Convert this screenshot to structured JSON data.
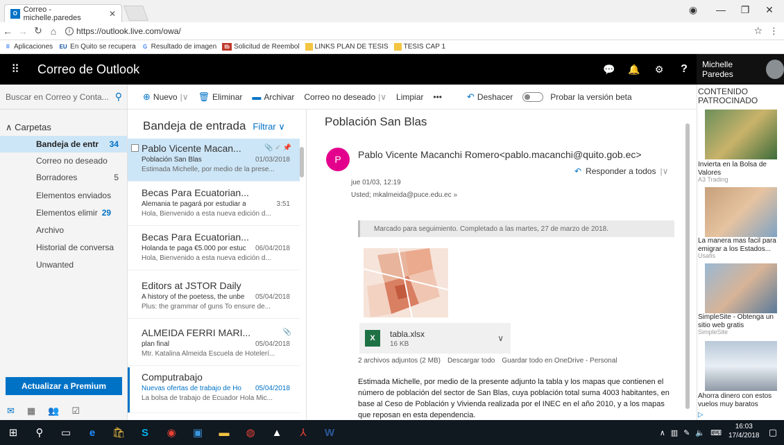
{
  "browser": {
    "tab_title": "Correo - michelle.paredes",
    "tab_icon": "O",
    "url": "https://outlook.live.com/owa/",
    "bookmarks": [
      {
        "label": "Aplicaciones"
      },
      {
        "label": "En Quito se recupera",
        "badge": "EU"
      },
      {
        "label": "Resultado de imagen",
        "badge": "G"
      },
      {
        "label": "Solicitud de Reembol",
        "badge": "tb"
      },
      {
        "label": "LINKS PLAN DE TESIS"
      },
      {
        "label": "TESIS CAP 1"
      }
    ]
  },
  "header": {
    "app_title": "Correo de Outlook",
    "user_name": "Michelle Paredes"
  },
  "search": {
    "placeholder": "Buscar en Correo y Conta..."
  },
  "folders": {
    "heading": "Carpetas",
    "items": [
      {
        "label": "Bandeja de entr",
        "count": "34"
      },
      {
        "label": "Correo no deseado",
        "count": ""
      },
      {
        "label": "Borradores",
        "count": "5"
      },
      {
        "label": "Elementos enviados",
        "count": ""
      },
      {
        "label": "Elementos elimir",
        "count": "29"
      },
      {
        "label": "Archivo",
        "count": ""
      },
      {
        "label": "Historial de conversa",
        "count": ""
      },
      {
        "label": "Unwanted",
        "count": ""
      }
    ]
  },
  "premium_label": "Actualizar a Premium",
  "commands": {
    "new": "Nuevo",
    "delete": "Eliminar",
    "archive": "Archivar",
    "junk": "Correo no deseado",
    "sweep": "Limpiar",
    "more": "•••",
    "undo": "Deshacer",
    "beta": "Probar la versión beta"
  },
  "list": {
    "title": "Bandeja de entrada",
    "filter": "Filtrar",
    "messages": [
      {
        "from": "Pablo Vicente Macan...",
        "subject": "Población San Blas",
        "date": "01/03/2018",
        "preview": "Estimada Michelle, por medio de la prese..."
      },
      {
        "from": "Becas Para Ecuatorian...",
        "subject": "Alemania te pagará por estudiar a",
        "date": "3:51",
        "preview": "Hola, Bienvenido a esta nueva edición d..."
      },
      {
        "from": "Becas Para Ecuatorian...",
        "subject": "Holanda te paga €5.000 por estuc",
        "date": "06/04/2018",
        "preview": "Hola, Bienvenido a esta nueva edición d..."
      },
      {
        "from": "Editors at JSTOR Daily",
        "subject": "A history of the poetess, the unbe",
        "date": "05/04/2018",
        "preview": "Plus: the grammar of guns To ensure de..."
      },
      {
        "from": "ALMEIDA FERRI MARI...",
        "subject": "plan final",
        "date": "05/04/2018",
        "preview": "Mtr. Katalina Almeida Escuela de Hotelerí..."
      },
      {
        "from": "Computrabajo",
        "subject": "Nuevas ofertas de trabajo de Ho",
        "date": "05/04/2018",
        "preview": "La bolsa de trabajo de Ecuador Hola Mic..."
      }
    ]
  },
  "reading": {
    "subject": "Población San Blas",
    "avatar_letter": "P",
    "avatar_color": "#e3008c",
    "from": "Pablo Vicente Macanchi Romero<pablo.macanchi@quito.gob.ec>",
    "reply_all": "Responder a todos",
    "date": "jue 01/03, 12:19",
    "to": "Usted; mkalmeida@puce.edu.ec",
    "flag_text": "Marcado para seguimiento. Completado a las martes, 27 de marzo de 2018.",
    "attachment": {
      "name": "tabla.xlsx",
      "size": "16 KB"
    },
    "attach_summary": "2 archivos adjuntos (2 MB)",
    "download_all": "Descargar todo",
    "save_all": "Guardar todo en OneDrive - Personal",
    "body": "Estimada Michelle, por medio de la presente adjunto la tabla y los mapas que contienen el número de población del sector de San Blas, cuya población total suma 4003 habitantes, en base al Ceso de Población y Vivienda realizada por el INEC en el año 2010, y a los mapas que reposan en esta dependencia."
  },
  "ads": {
    "heading": "CONTENIDO PATROCINADO",
    "items": [
      {
        "text": "Invierta en la Bolsa de Valores",
        "source": "A3 Trading"
      },
      {
        "text": "La manera mas facil para emigrar a los Estados...",
        "source": "Usafis"
      },
      {
        "text": "SimpleSite - Obtenga un sitio web gratis",
        "source": "SimpleSite"
      },
      {
        "text": "Ahorra dinero con estos vuelos muy baratos",
        "source": ""
      }
    ]
  },
  "taskbar": {
    "time": "16:03",
    "date": "17/4/2018"
  },
  "colors": {
    "accent": "#0072c6",
    "selected": "#cde6f7",
    "header": "#000000"
  }
}
